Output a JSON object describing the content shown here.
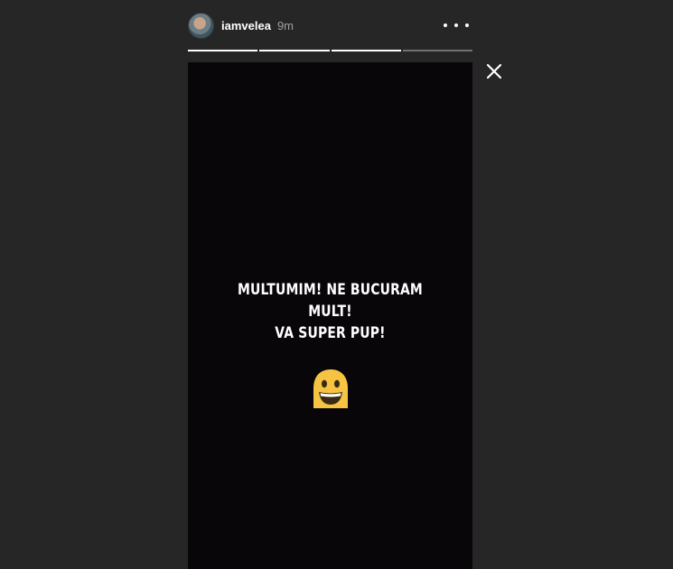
{
  "header": {
    "username": "iamvelea",
    "timestamp": "9m"
  },
  "progress": {
    "segments": [
      1,
      1,
      1,
      0
    ]
  },
  "story": {
    "text_line1": "MULTUMIM! NE BUCURAM MULT!",
    "text_line2": "VA SUPER PUP!",
    "sticker": "grinning-blob-emoji",
    "background_color": "#080609"
  },
  "icons": {
    "more": "more-options-icon",
    "close": "close-icon"
  },
  "colors": {
    "page_background": "#262626",
    "emoji_yellow": "#f6c343"
  }
}
